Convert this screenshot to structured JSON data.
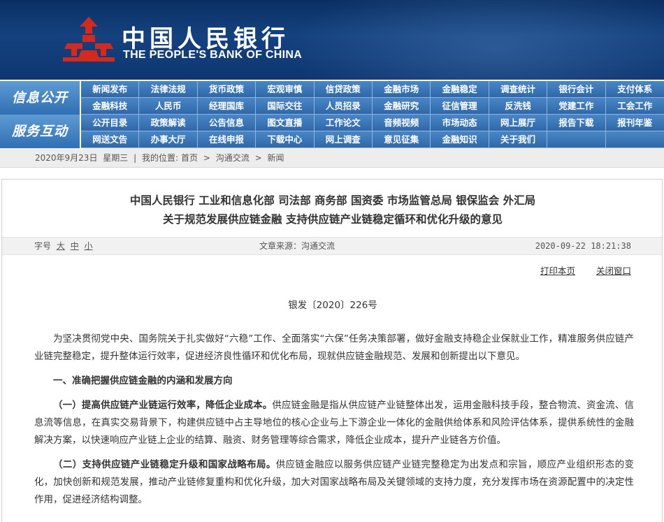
{
  "header": {
    "title_cn": "中国人民银行",
    "title_en": "THE PEOPLE'S BANK OF CHINA"
  },
  "colors": {
    "header_bg": "#14427f",
    "nav_bg": "#3a78b9",
    "logo_red": "#d42a1e"
  },
  "icons": [
    "bank-logo-icon"
  ],
  "nav": {
    "section1": {
      "label": "信息公开",
      "items": [
        "新闻发布",
        "法律法规",
        "货币政策",
        "宏观审慎",
        "信贷政策",
        "金融市场",
        "金融稳定",
        "调查统计",
        "银行会计",
        "支付体系",
        "金融科技",
        "人民币",
        "经理国库",
        "国际交往",
        "人员招录",
        "金融研究",
        "征信管理",
        "反洗钱",
        "党建工作",
        "工会工作"
      ]
    },
    "section2": {
      "label": "服务互动",
      "items": [
        "公开目录",
        "政策解读",
        "公告信息",
        "图文直播",
        "工作论文",
        "音频视频",
        "市场动态",
        "网上展厅",
        "报告下载",
        "报刊年鉴",
        "网送文告",
        "办事大厅",
        "在线申报",
        "下载中心",
        "网上调查",
        "意见征集",
        "金融知识",
        "关于我们",
        "",
        ""
      ]
    }
  },
  "breadcrumb": {
    "date": "2020年9月23日",
    "weekday": "星期三",
    "sep": "|",
    "location_label": "我的位置:",
    "home": "首页",
    "arrow": ">",
    "level1": "沟通交流",
    "level2": "新闻"
  },
  "article": {
    "title_line1": "中国人民银行  工业和信息化部  司法部  商务部  国资委  市场监管总局  银保监会  外汇局",
    "title_line2": "关于规范发展供应链金融  支持供应链产业链稳定循环和优化升级的意见",
    "meta": {
      "font_label": "字号",
      "font_large": "大",
      "font_medium": "中",
      "font_small": "小",
      "source": "文章来源：沟通交流",
      "datetime": "2020-09-22 18:21:38"
    },
    "print_label": "打印本页",
    "close_label": "关闭窗口",
    "doc_number": "银发〔2020〕226号",
    "intro": "为坚决贯彻党中央、国务院关于扎实做好“六稳”工作、全面落实“六保”任务决策部署，做好金融支持稳企业保就业工作，精准服务供应链产业链完整稳定，提升整体运行效率，促进经济良性循环和优化布局，现就供应链金融规范、发展和创新提出以下意见。",
    "section1_heading": "一、准确把握供应链金融的内涵和发展方向",
    "item1_lead": "（一）提高供应链产业链运行效率，降低企业成本。",
    "item1_text": "供应链金融是指从供应链产业链整体出发，运用金融科技手段，整合物流、资金流、信息流等信息，在真实交易背景下，构建供应链中占主导地位的核心企业与上下游企业一体化的金融供给体系和风险评估体系，提供系统性的金融解决方案，以快速响应产业链上企业的结算、融资、财务管理等综合需求，降低企业成本，提升产业链各方价值。",
    "item2_lead": "（二）支持供应链产业链稳定升级和国家战略布局。",
    "item2_text": "供应链金融应以服务供应链产业链完整稳定为出发点和宗旨，顺应产业组织形态的变化，加快创新和规范发展，推动产业链修复重构和优化升级，加大对国家战略布局及关键领域的支持力度，充分发挥市场在资源配置中的决定性作用，促进经济结构调整。"
  }
}
